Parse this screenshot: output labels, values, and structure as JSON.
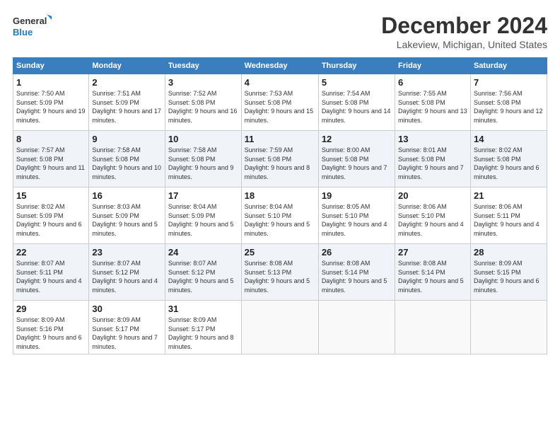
{
  "header": {
    "logo_line1": "General",
    "logo_line2": "Blue",
    "month": "December 2024",
    "location": "Lakeview, Michigan, United States"
  },
  "days_of_week": [
    "Sunday",
    "Monday",
    "Tuesday",
    "Wednesday",
    "Thursday",
    "Friday",
    "Saturday"
  ],
  "weeks": [
    [
      {
        "day": "1",
        "info": "Sunrise: 7:50 AM\nSunset: 5:09 PM\nDaylight: 9 hours and 19 minutes."
      },
      {
        "day": "2",
        "info": "Sunrise: 7:51 AM\nSunset: 5:09 PM\nDaylight: 9 hours and 17 minutes."
      },
      {
        "day": "3",
        "info": "Sunrise: 7:52 AM\nSunset: 5:08 PM\nDaylight: 9 hours and 16 minutes."
      },
      {
        "day": "4",
        "info": "Sunrise: 7:53 AM\nSunset: 5:08 PM\nDaylight: 9 hours and 15 minutes."
      },
      {
        "day": "5",
        "info": "Sunrise: 7:54 AM\nSunset: 5:08 PM\nDaylight: 9 hours and 14 minutes."
      },
      {
        "day": "6",
        "info": "Sunrise: 7:55 AM\nSunset: 5:08 PM\nDaylight: 9 hours and 13 minutes."
      },
      {
        "day": "7",
        "info": "Sunrise: 7:56 AM\nSunset: 5:08 PM\nDaylight: 9 hours and 12 minutes."
      }
    ],
    [
      {
        "day": "8",
        "info": "Sunrise: 7:57 AM\nSunset: 5:08 PM\nDaylight: 9 hours and 11 minutes."
      },
      {
        "day": "9",
        "info": "Sunrise: 7:58 AM\nSunset: 5:08 PM\nDaylight: 9 hours and 10 minutes."
      },
      {
        "day": "10",
        "info": "Sunrise: 7:58 AM\nSunset: 5:08 PM\nDaylight: 9 hours and 9 minutes."
      },
      {
        "day": "11",
        "info": "Sunrise: 7:59 AM\nSunset: 5:08 PM\nDaylight: 9 hours and 8 minutes."
      },
      {
        "day": "12",
        "info": "Sunrise: 8:00 AM\nSunset: 5:08 PM\nDaylight: 9 hours and 7 minutes."
      },
      {
        "day": "13",
        "info": "Sunrise: 8:01 AM\nSunset: 5:08 PM\nDaylight: 9 hours and 7 minutes."
      },
      {
        "day": "14",
        "info": "Sunrise: 8:02 AM\nSunset: 5:08 PM\nDaylight: 9 hours and 6 minutes."
      }
    ],
    [
      {
        "day": "15",
        "info": "Sunrise: 8:02 AM\nSunset: 5:09 PM\nDaylight: 9 hours and 6 minutes."
      },
      {
        "day": "16",
        "info": "Sunrise: 8:03 AM\nSunset: 5:09 PM\nDaylight: 9 hours and 5 minutes."
      },
      {
        "day": "17",
        "info": "Sunrise: 8:04 AM\nSunset: 5:09 PM\nDaylight: 9 hours and 5 minutes."
      },
      {
        "day": "18",
        "info": "Sunrise: 8:04 AM\nSunset: 5:10 PM\nDaylight: 9 hours and 5 minutes."
      },
      {
        "day": "19",
        "info": "Sunrise: 8:05 AM\nSunset: 5:10 PM\nDaylight: 9 hours and 4 minutes."
      },
      {
        "day": "20",
        "info": "Sunrise: 8:06 AM\nSunset: 5:10 PM\nDaylight: 9 hours and 4 minutes."
      },
      {
        "day": "21",
        "info": "Sunrise: 8:06 AM\nSunset: 5:11 PM\nDaylight: 9 hours and 4 minutes."
      }
    ],
    [
      {
        "day": "22",
        "info": "Sunrise: 8:07 AM\nSunset: 5:11 PM\nDaylight: 9 hours and 4 minutes."
      },
      {
        "day": "23",
        "info": "Sunrise: 8:07 AM\nSunset: 5:12 PM\nDaylight: 9 hours and 4 minutes."
      },
      {
        "day": "24",
        "info": "Sunrise: 8:07 AM\nSunset: 5:12 PM\nDaylight: 9 hours and 5 minutes."
      },
      {
        "day": "25",
        "info": "Sunrise: 8:08 AM\nSunset: 5:13 PM\nDaylight: 9 hours and 5 minutes."
      },
      {
        "day": "26",
        "info": "Sunrise: 8:08 AM\nSunset: 5:14 PM\nDaylight: 9 hours and 5 minutes."
      },
      {
        "day": "27",
        "info": "Sunrise: 8:08 AM\nSunset: 5:14 PM\nDaylight: 9 hours and 5 minutes."
      },
      {
        "day": "28",
        "info": "Sunrise: 8:09 AM\nSunset: 5:15 PM\nDaylight: 9 hours and 6 minutes."
      }
    ],
    [
      {
        "day": "29",
        "info": "Sunrise: 8:09 AM\nSunset: 5:16 PM\nDaylight: 9 hours and 6 minutes."
      },
      {
        "day": "30",
        "info": "Sunrise: 8:09 AM\nSunset: 5:17 PM\nDaylight: 9 hours and 7 minutes."
      },
      {
        "day": "31",
        "info": "Sunrise: 8:09 AM\nSunset: 5:17 PM\nDaylight: 9 hours and 8 minutes."
      },
      {
        "day": "",
        "info": ""
      },
      {
        "day": "",
        "info": ""
      },
      {
        "day": "",
        "info": ""
      },
      {
        "day": "",
        "info": ""
      }
    ]
  ]
}
